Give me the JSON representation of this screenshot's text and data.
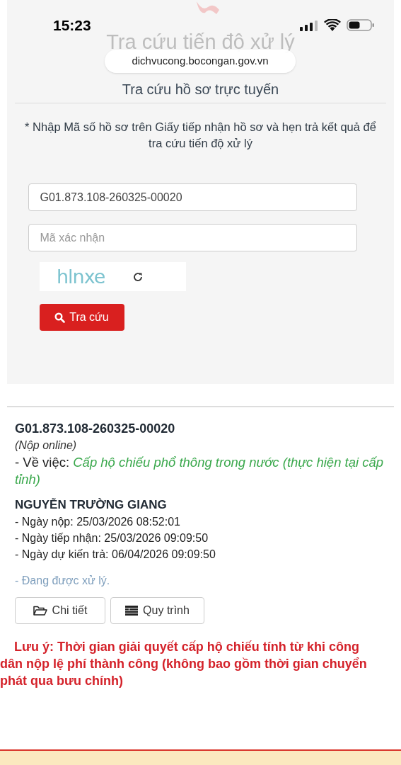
{
  "status_bar": {
    "time": "15:23"
  },
  "browser": {
    "url": "dichvucong.bocongan.gov.vn"
  },
  "page": {
    "heading": "Tra cứu tiến độ xử lý"
  },
  "search_form": {
    "title": "Tra cứu hồ sơ trực tuyến",
    "instruction": "* Nhập Mã số hồ sơ trên Giấy tiếp nhận hồ sơ và hẹn trả kết quả để tra cứu tiến độ xử lý",
    "code_field": {
      "value": "G01.873.108-260325-00020"
    },
    "captcha_field": {
      "placeholder": "Mã xác nhận"
    },
    "captcha": {
      "text": "hlnxe"
    },
    "submit_button": {
      "label": "Tra cứu"
    }
  },
  "result": {
    "code": "G01.873.108-260325-00020",
    "mode": "(Nộp online)",
    "subject_label": "- Về việc:",
    "subject": "Cấp hộ chiếu phổ thông trong nước (thực hiện tại cấp tỉnh)",
    "applicant": "NGUYỄN TRƯỜNG GIANG",
    "dates": [
      "- Ngày nộp: 25/03/2026 08:52:01",
      "- Ngày tiếp nhận: 25/03/2026 09:09:50",
      "- Ngày dự kiến trả: 06/04/2026 09:09:50"
    ],
    "status": "- Đang được xử lý.",
    "buttons": [
      {
        "label": "Chi tiết",
        "kind": "folder"
      },
      {
        "label": "Quy trình",
        "kind": "list"
      }
    ],
    "note": "Lưu ý: Thời gian giải quyết cấp hộ chiếu tính từ khi công dân nộp lệ phí thành công (không bao gồm thời gian chuyển phát qua bưu chính)"
  }
}
